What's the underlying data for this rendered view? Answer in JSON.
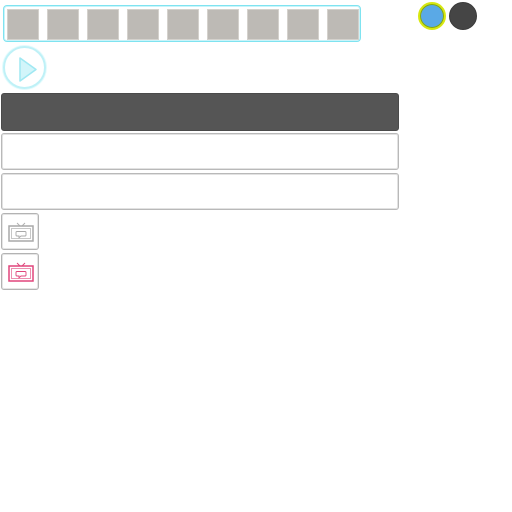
{
  "tiles": [
    {
      "id": "tile-1"
    },
    {
      "id": "tile-2"
    },
    {
      "id": "tile-3"
    },
    {
      "id": "tile-4"
    },
    {
      "id": "tile-5"
    },
    {
      "id": "tile-6"
    },
    {
      "id": "tile-7"
    },
    {
      "id": "tile-8"
    },
    {
      "id": "tile-9"
    }
  ],
  "swatches": [
    {
      "name": "blue",
      "color": "#5aa9e6",
      "selected": true
    },
    {
      "name": "dark",
      "color": "#454545",
      "selected": false
    }
  ],
  "controls": {
    "play_icon": "play-icon",
    "tv_icon_default_color": "#a9a9a9",
    "tv_icon_active_color": "#e0457b"
  },
  "fields": [
    {
      "value": "",
      "placeholder": ""
    },
    {
      "value": "",
      "placeholder": ""
    }
  ]
}
